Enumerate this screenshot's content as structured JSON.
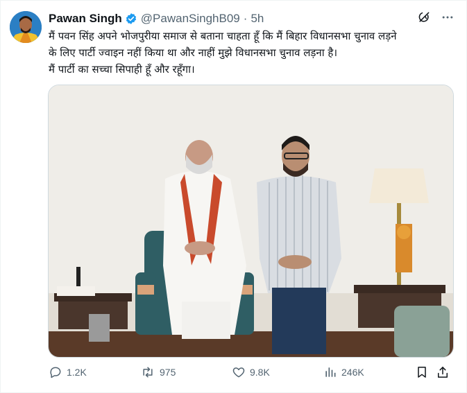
{
  "tweet": {
    "author_name": "Pawan Singh",
    "handle": "@PawanSinghB09",
    "separator": "·",
    "time": "5h",
    "text_lines": [
      "मैं पवन सिंह अपने भोजपुरीया समाज से बताना चाहता हूँ कि मैं बिहार विधानसभा चुनाव लड़ने",
      "के लिए पार्टी ज्वाइन नहीं किया था और नाहीं मुझे विधानसभा चुनाव लड़ना है।",
      "मैं पार्टी का सच्चा सिपाही हूँ और रहूँगा।"
    ]
  },
  "metrics": {
    "replies": "1.2K",
    "reposts": "975",
    "likes": "9.8K",
    "views": "246K"
  },
  "icons": {
    "verified": "verified-badge-icon",
    "grok": "grok-icon",
    "more": "more-icon",
    "reply": "reply-icon",
    "repost": "repost-icon",
    "like": "like-icon",
    "views": "views-icon",
    "bookmark": "bookmark-icon",
    "share": "share-icon"
  },
  "colors": {
    "verified": "#1d9bf0",
    "muted": "#536471",
    "text": "#0f1419"
  }
}
